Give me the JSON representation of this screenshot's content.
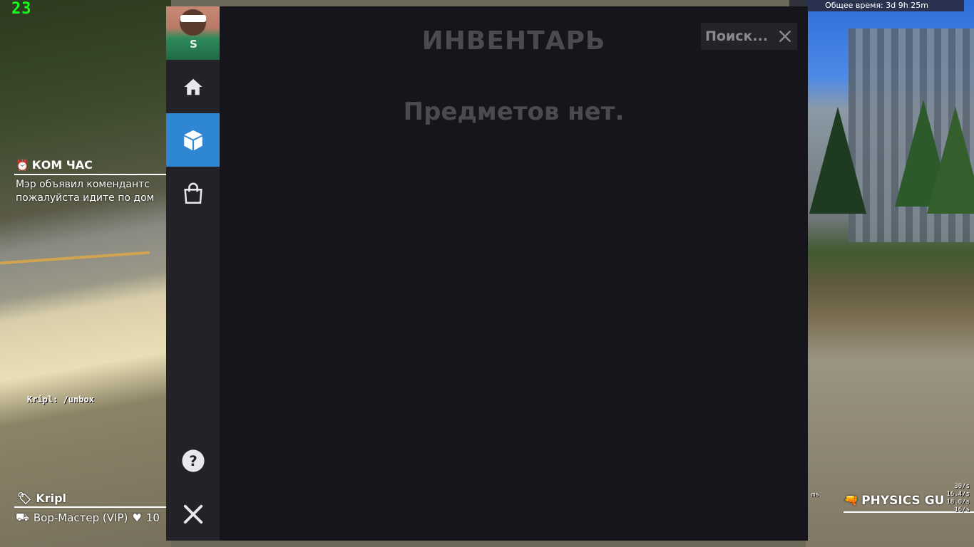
{
  "hud": {
    "fps": "23",
    "total_time": "Общее время: 3d 9h 25m"
  },
  "event": {
    "title": "КОМ ЧАС",
    "line1": "Мэр объявил комендантс",
    "line2": "пожалуйста идите по дом"
  },
  "chat": {
    "line": "Kripl: /unbox"
  },
  "player": {
    "name": "Kripl",
    "job": "Вор-Мастер (VIP)",
    "health": "10"
  },
  "weapon": {
    "name": "PHYSICS GU"
  },
  "netgraph": {
    "ms": "ms",
    "lines": [
      "30/s",
      "16.4/s",
      "18.0/s",
      "16/s"
    ]
  },
  "inventory": {
    "title": "ИНВЕНТАРЬ",
    "empty_message": "Предметов нет.",
    "search_placeholder": "Поиск...",
    "avatar_letter": "S"
  },
  "sidebar": {
    "items": [
      {
        "icon": "home-icon"
      },
      {
        "icon": "cube-icon",
        "active": true
      },
      {
        "icon": "shopping-bag-icon"
      },
      {
        "icon": "help-icon"
      },
      {
        "icon": "close-icon"
      }
    ]
  },
  "colors": {
    "accent": "#2f86d3",
    "panel_bg": "#16151b",
    "sidebar_bg": "#232228",
    "muted_text": "#4b4a51",
    "fps_green": "#19ff19"
  }
}
